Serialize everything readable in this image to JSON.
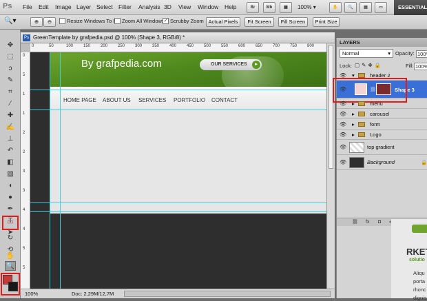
{
  "app": {
    "logo": "Ps"
  },
  "menu": [
    "File",
    "Edit",
    "Image",
    "Layer",
    "Select",
    "Filter",
    "Analysis",
    "3D",
    "View",
    "Window",
    "Help"
  ],
  "menubar_icons": [
    {
      "name": "bridge-icon",
      "label": "Br"
    },
    {
      "name": "minibridge-icon",
      "label": "Mb"
    },
    {
      "name": "guides-icon",
      "label": "▦"
    },
    {
      "name": "hand-view-icon",
      "label": "✋"
    },
    {
      "name": "zoom-view-icon",
      "label": "🔍"
    }
  ],
  "zoom_level": "100%",
  "workspace": "ESSENTIALS",
  "options": {
    "resize_windows": {
      "label": "Resize Windows To Fit",
      "checked": false
    },
    "zoom_all": {
      "label": "Zoom All Windows",
      "checked": false
    },
    "scrubby_zoom": {
      "label": "Scrubby Zoom",
      "checked": true
    },
    "actual_pixels": "Actual Pixels",
    "fit_screen": "Fit Screen",
    "fill_screen": "Fill Screen",
    "print_size": "Print Size"
  },
  "document": {
    "title": "GreenTemplate by grafpedia.psd @ 100% (Shape 3, RGB/8) *",
    "status_zoom": "100%",
    "status_doc": "Doc: 2,29M/12,7M",
    "ruler_h": [
      "0",
      "50",
      "100",
      "150",
      "200",
      "250",
      "300",
      "350",
      "400",
      "450",
      "500",
      "550",
      "600",
      "650",
      "700",
      "750",
      "800"
    ],
    "ruler_v": [
      "0",
      "5",
      "1",
      "1",
      "2",
      "2",
      "3",
      "3",
      "4",
      "4",
      "5",
      "5"
    ]
  },
  "page": {
    "brand": "By grafpedia.com",
    "our_services": "OUR SERVICES",
    "nav": [
      "HOME PAGE",
      "ABOUT US",
      "SERVICES",
      "PORTFOLIO",
      "CONTACT"
    ]
  },
  "layers_panel": {
    "tab": "LAYERS",
    "blend_mode": "Normal",
    "opacity_label": "Opacity:",
    "opacity_value": "100%",
    "lock_label": "Lock:",
    "fill_label": "Fill:",
    "fill_value": "100%",
    "layers": [
      {
        "name": "header 2",
        "type": "group"
      },
      {
        "name": "Shape 3",
        "type": "shape",
        "active": true
      },
      {
        "name": "menu",
        "type": "group"
      },
      {
        "name": "carousel",
        "type": "group"
      },
      {
        "name": "form",
        "type": "group"
      },
      {
        "name": "Logo",
        "type": "group"
      },
      {
        "name": "top gradient",
        "type": "layer"
      },
      {
        "name": "Background",
        "type": "background"
      }
    ]
  },
  "peek": {
    "title": "RKET",
    "sub": "solutio",
    "text": [
      "Aliqu",
      "porta",
      "rhonc",
      "dignis"
    ]
  },
  "colors": {
    "accent_green": "#5b9a22",
    "highlight_red": "#e31b1b",
    "active_layer": "#3a6fd8",
    "guide": "#3fd0e0"
  }
}
